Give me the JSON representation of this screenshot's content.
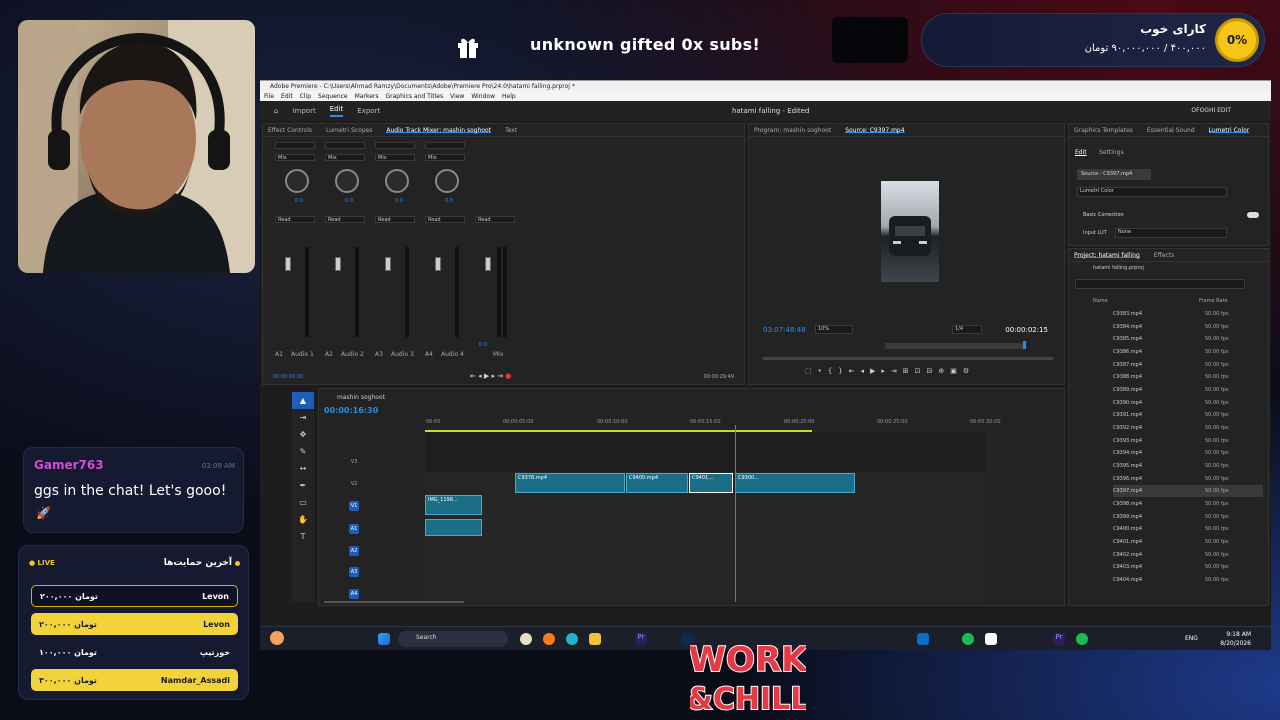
{
  "stream": {
    "gift_text": "unknown gifted 0x subs!",
    "goal": {
      "title": "کارای خوب",
      "amount": "۴۰۰,۰۰۰ / ۹۰,۰۰۰,۰۰۰ تومان",
      "percent": "0%"
    },
    "chat": {
      "user": "Gamer763",
      "time": "03:09 AM",
      "message": "ggs in the chat! Let's gooo!",
      "emoji": "🚀"
    },
    "donations": {
      "live": "● LIVE",
      "title": "آخرین حمایت‌ها",
      "items": [
        {
          "name": "Levon",
          "amount": "۲۰۰,۰۰۰ تومان"
        },
        {
          "name": "Levon",
          "amount": "۲۰۰,۰۰۰ تومان"
        },
        {
          "name": "خوزتیپ",
          "amount": "۱۰۰,۰۰۰ تومان"
        },
        {
          "name": "Namdar_Assadi",
          "amount": "۳۰۰,۰۰۰ تومان"
        }
      ]
    },
    "logo_text": "WORK & CHILL"
  },
  "premiere": {
    "title": "Adobe Premiere - C:\\Users\\Ahmad Ramzy\\Documents\\Adobe\\Premiere Pro\\24.0\\hatami falling.prproj *",
    "menu": [
      "File",
      "Edit",
      "Clip",
      "Sequence",
      "Markers",
      "Graphics and Titles",
      "View",
      "Window",
      "Help"
    ],
    "header_tabs": [
      "Import",
      "Edit",
      "Export"
    ],
    "project_title": "hatami falling - Edited",
    "workspace": "OFOGHI EDIT",
    "left_tabs": [
      "Effect Controls",
      "Lumetri Scopes",
      "Audio Track Mixer: mashin soghoot",
      "Text"
    ],
    "mixer": {
      "channels": [
        {
          "id": "A1",
          "name": "Audio 1",
          "value": "0.0"
        },
        {
          "id": "A2",
          "name": "Audio 2",
          "value": "0.0"
        },
        {
          "id": "A3",
          "name": "Audio 3",
          "value": "0.0"
        },
        {
          "id": "A4",
          "name": "Audio 4",
          "value": "0.0"
        },
        {
          "id": "",
          "name": "Mix",
          "value": "0.0"
        }
      ],
      "mode": "Mix",
      "read": "Read",
      "timecode_left": "00:00:16:30",
      "timecode_right": "00:00:29:49"
    },
    "monitor": {
      "tabs": [
        "Program: mashin soghoot",
        "Source: C9397.mp4"
      ],
      "timecode": "03:07:48:48",
      "zoom": "10%",
      "fraction": "1/4",
      "duration": "00:00:02:15"
    },
    "timeline": {
      "sequence": "mashin soghoot",
      "timecode": "00:00:16:30",
      "ruler": [
        "00:00",
        "00:00:05:00",
        "00:00:10:00",
        "00:00:15:00",
        "00:00:20:00",
        "00:00:25:00",
        "00:00:30:00"
      ],
      "video_tracks": [
        "V3",
        "V2",
        "V1"
      ],
      "audio_tracks": [
        "A1",
        "A2",
        "A3",
        "A4"
      ],
      "clips": [
        "C9378.mp4",
        "C9400.mp4",
        "C9401...",
        "C9300...",
        "IMG_1198..."
      ]
    },
    "right": {
      "tabs": [
        "Graphics Templates",
        "Essential Sound",
        "Lumetri Color"
      ],
      "subtabs": [
        "Edit",
        "Settings"
      ],
      "source": "Source - C9397.mp4",
      "lumetri": "Lumetri Color",
      "basic": "Basic Correction",
      "input_lut_label": "Input LUT",
      "input_lut_value": "None",
      "project_tabs": [
        "Project: hatami falling",
        "Effects"
      ],
      "project_file": "hatami falling.prproj",
      "col_name": "Name",
      "col_rate": "Frame Rate",
      "files": [
        "C9383.mp4",
        "C9384.mp4",
        "C9385.mp4",
        "C9386.mp4",
        "C9387.mp4",
        "C9388.mp4",
        "C9389.mp4",
        "C9390.mp4",
        "C9391.mp4",
        "C9392.mp4",
        "C9393.mp4",
        "C9394.mp4",
        "C9395.mp4",
        "C9396.mp4",
        "C9397.mp4",
        "C9398.mp4",
        "C9399.mp4",
        "C9400.mp4",
        "C9401.mp4",
        "C9402.mp4",
        "C9403.mp4",
        "C9404.mp4"
      ],
      "fps": "50.00 fps"
    },
    "taskbar": {
      "search": "Search",
      "lang": "ENG",
      "time": "9:18 AM",
      "date": "8/20/2026"
    }
  }
}
